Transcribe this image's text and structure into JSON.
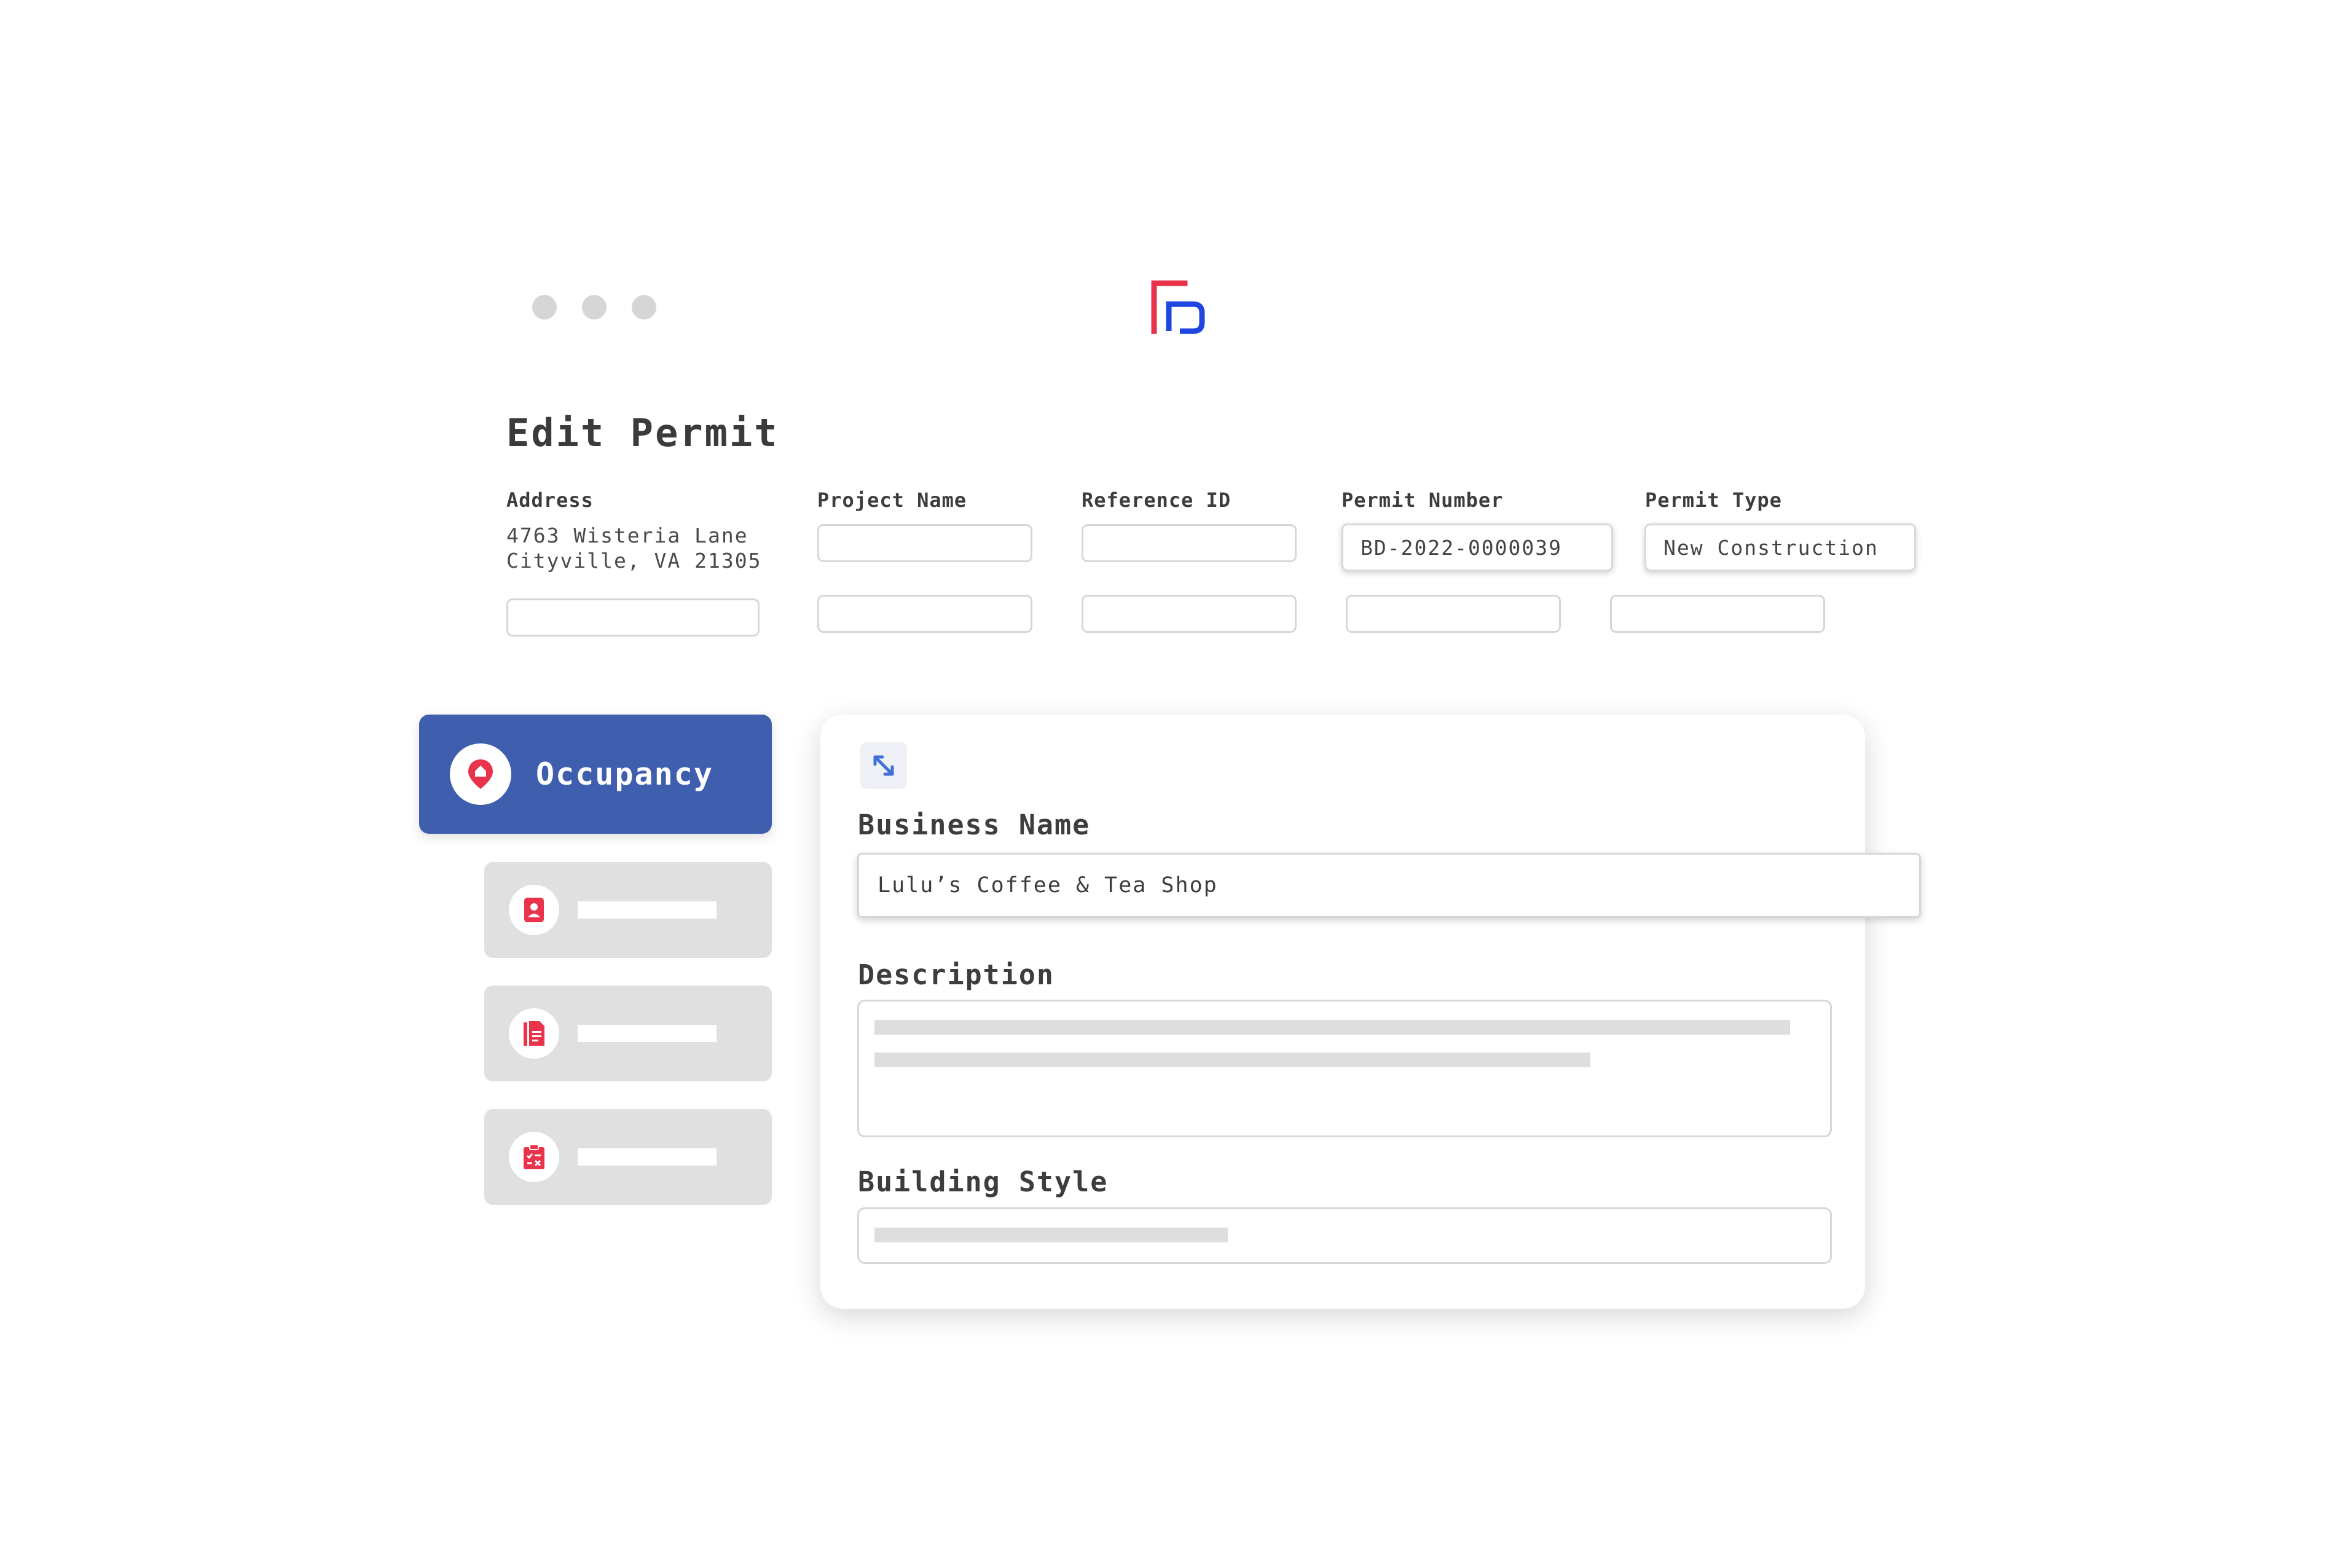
{
  "window": {
    "controls": [
      "window-dot",
      "window-dot",
      "window-dot"
    ],
    "logo_colors": {
      "red": "#e8334a",
      "blue": "#1f46e0"
    }
  },
  "page": {
    "title": "Edit Permit"
  },
  "header_fields": {
    "address_label": "Address",
    "address_line1": "4763 Wisteria Lane",
    "address_line2": "Cityville, VA 21305",
    "project_name_label": "Project Name",
    "reference_id_label": "Reference ID",
    "permit_number_label": "Permit Number",
    "permit_number_value": "BD-2022-0000039",
    "permit_type_label": "Permit Type",
    "permit_type_value": "New Construction"
  },
  "sidebar": {
    "active_label": "Occupancy",
    "active_color": "#3f5fae",
    "items": [
      {
        "icon": "contact-card-icon"
      },
      {
        "icon": "document-icon"
      },
      {
        "icon": "clipboard-checklist-icon"
      }
    ]
  },
  "form": {
    "expand_icon": "expand-icon",
    "business_name_label": "Business Name",
    "business_name_value": "Lulu’s Coffee & Tea Shop",
    "description_label": "Description",
    "building_style_label": "Building Style"
  },
  "colors": {
    "accent_red": "#e8334a",
    "accent_blue": "#3f5fae"
  }
}
